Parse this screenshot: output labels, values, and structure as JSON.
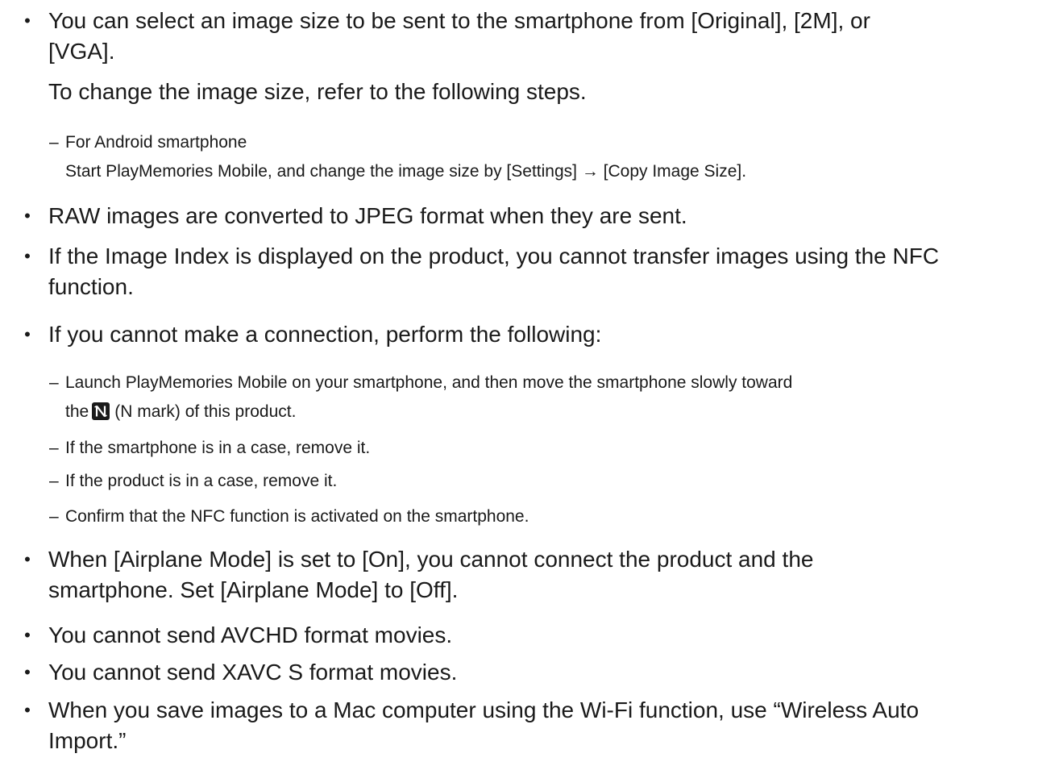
{
  "notes": {
    "image_size": {
      "lines": [
        "You can select an image size to be sent to the smartphone from [Original], [2M], or",
        "[VGA].",
        "To change the image size, refer to the following steps."
      ],
      "android": {
        "title": "For Android smartphone",
        "text": "Start PlayMemories Mobile, and change the image size by [Settings] → [Copy Image Size]."
      }
    },
    "raw": "RAW images are converted to JPEG format when they are sent.",
    "image_index": [
      "If the Image Index is displayed on the product, you cannot transfer images using the NFC",
      "function."
    ],
    "cannot_connect": {
      "text": "If you cannot make a connection, perform the following:",
      "steps": {
        "launch_line1": "Launch PlayMemories Mobile on your smartphone, and then move the smartphone slowly toward",
        "launch_prefix": "the",
        "launch_suffix": "(N mark) of this product.",
        "smartphone_case": "If the smartphone is in a case, remove it.",
        "product_case": "If the product is in a case, remove it.",
        "nfc_activated": "Confirm that the NFC function is activated on the smartphone."
      }
    },
    "airplane": [
      "When [Airplane Mode] is set to [On], you cannot connect the product and the",
      "smartphone. Set [Airplane Mode] to [Off]."
    ],
    "avchd": "You cannot send AVCHD format movies.",
    "xavc": "You cannot send XAVC S format movies.",
    "mac": [
      "When you save images to a Mac computer using the Wi-Fi function, use “Wireless Auto",
      "Import.”"
    ]
  },
  "symbols": {
    "bullet": "•",
    "dash": "–",
    "nfc_icon": "n-mark-icon"
  },
  "colors": {
    "text": "#1a1a1a",
    "icon_bg": "#1a1a1a",
    "icon_fg": "#ffffff"
  }
}
